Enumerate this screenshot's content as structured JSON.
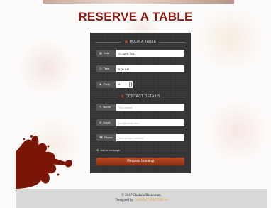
{
  "page": {
    "title": "RESERVE A TABLE"
  },
  "booking": {
    "heading": "BOOK A TABLE",
    "date": {
      "label": "Date",
      "value": "22 April, 2014",
      "icon": "calendar-icon"
    },
    "time": {
      "label": "Time",
      "value": "8:00 PM",
      "icon": "clock-icon"
    },
    "party": {
      "label": "Party",
      "value": "4",
      "icon": "user-icon"
    }
  },
  "contact": {
    "heading": "CONTACT DETAILS",
    "name": {
      "label": "Name",
      "placeholder": "Your name",
      "icon": "pencil-icon"
    },
    "email": {
      "label": "Email",
      "placeholder": "you@email.com",
      "icon": "envelope-icon"
    },
    "phone": {
      "label": "Phone",
      "placeholder": "Your phone number",
      "icon": "phone-icon"
    }
  },
  "add_message": "Add a message",
  "submit_label": "Request booking",
  "footer": {
    "copyright": "© 2017 Chakula Restaurant.",
    "designed_by_prefix": "Designed by",
    "designer": "COSMIC SPECTRUM"
  },
  "colors": {
    "title": "#8a1a12",
    "panel": "#333333",
    "button": "#a53e1a",
    "accent": "#c8502a",
    "footer_bg": "#d9d9d9",
    "designer_link": "#e0a23a"
  }
}
